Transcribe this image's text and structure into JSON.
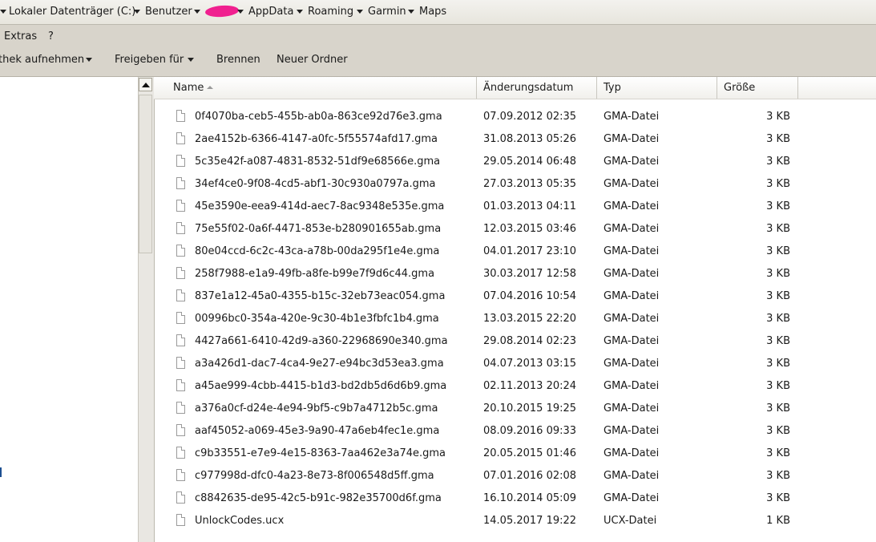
{
  "address": {
    "crumbs": [
      "Lokaler Datenträger (C:)",
      "Benutzer",
      "AppData",
      "Roaming",
      "Garmin",
      "Maps"
    ]
  },
  "menubar": {
    "items": [
      "Extras",
      "?"
    ]
  },
  "toolbar": {
    "library_label": "thek aufnehmen",
    "share_label": "Freigeben für",
    "burn_label": "Brennen",
    "new_folder_label": "Neuer Ordner"
  },
  "columns": {
    "name": "Name",
    "date": "Änderungsdatum",
    "type": "Typ",
    "size": "Größe"
  },
  "files": [
    {
      "name": "0f4070ba-ceb5-455b-ab0a-863ce92d76e3.gma",
      "date": "07.09.2012 02:35",
      "type": "GMA-Datei",
      "size": "3 KB"
    },
    {
      "name": "2ae4152b-6366-4147-a0fc-5f55574afd17.gma",
      "date": "31.08.2013 05:26",
      "type": "GMA-Datei",
      "size": "3 KB"
    },
    {
      "name": "5c35e42f-a087-4831-8532-51df9e68566e.gma",
      "date": "29.05.2014 06:48",
      "type": "GMA-Datei",
      "size": "3 KB"
    },
    {
      "name": "34ef4ce0-9f08-4cd5-abf1-30c930a0797a.gma",
      "date": "27.03.2013 05:35",
      "type": "GMA-Datei",
      "size": "3 KB"
    },
    {
      "name": "45e3590e-eea9-414d-aec7-8ac9348e535e.gma",
      "date": "01.03.2013 04:11",
      "type": "GMA-Datei",
      "size": "3 KB"
    },
    {
      "name": "75e55f02-0a6f-4471-853e-b280901655ab.gma",
      "date": "12.03.2015 03:46",
      "type": "GMA-Datei",
      "size": "3 KB"
    },
    {
      "name": "80e04ccd-6c2c-43ca-a78b-00da295f1e4e.gma",
      "date": "04.01.2017 23:10",
      "type": "GMA-Datei",
      "size": "3 KB"
    },
    {
      "name": "258f7988-e1a9-49fb-a8fe-b99e7f9d6c44.gma",
      "date": "30.03.2017 12:58",
      "type": "GMA-Datei",
      "size": "3 KB"
    },
    {
      "name": "837e1a12-45a0-4355-b15c-32eb73eac054.gma",
      "date": "07.04.2016 10:54",
      "type": "GMA-Datei",
      "size": "3 KB"
    },
    {
      "name": "00996bc0-354a-420e-9c30-4b1e3fbfc1b4.gma",
      "date": "13.03.2015 22:20",
      "type": "GMA-Datei",
      "size": "3 KB"
    },
    {
      "name": "4427a661-6410-42d9-a360-22968690e340.gma",
      "date": "29.08.2014 02:23",
      "type": "GMA-Datei",
      "size": "3 KB"
    },
    {
      "name": "a3a426d1-dac7-4ca4-9e27-e94bc3d53ea3.gma",
      "date": "04.07.2013 03:15",
      "type": "GMA-Datei",
      "size": "3 KB"
    },
    {
      "name": "a45ae999-4cbb-4415-b1d3-bd2db5d6d6b9.gma",
      "date": "02.11.2013 20:24",
      "type": "GMA-Datei",
      "size": "3 KB"
    },
    {
      "name": "a376a0cf-d24e-4e94-9bf5-c9b7a4712b5c.gma",
      "date": "20.10.2015 19:25",
      "type": "GMA-Datei",
      "size": "3 KB"
    },
    {
      "name": "aaf45052-a069-45e3-9a90-47a6eb4fec1e.gma",
      "date": "08.09.2016 09:33",
      "type": "GMA-Datei",
      "size": "3 KB"
    },
    {
      "name": "c9b33551-e7e9-4e15-8363-7aa462e3a74e.gma",
      "date": "20.05.2015 01:46",
      "type": "GMA-Datei",
      "size": "3 KB"
    },
    {
      "name": "c977998d-dfc0-4a23-8e73-8f006548d5ff.gma",
      "date": "07.01.2016 02:08",
      "type": "GMA-Datei",
      "size": "3 KB"
    },
    {
      "name": "c8842635-de95-42c5-b91c-982e35700d6f.gma",
      "date": "16.10.2014 05:09",
      "type": "GMA-Datei",
      "size": "3 KB"
    },
    {
      "name": "UnlockCodes.ucx",
      "date": "14.05.2017 19:22",
      "type": "UCX-Datei",
      "size": "1 KB"
    }
  ]
}
